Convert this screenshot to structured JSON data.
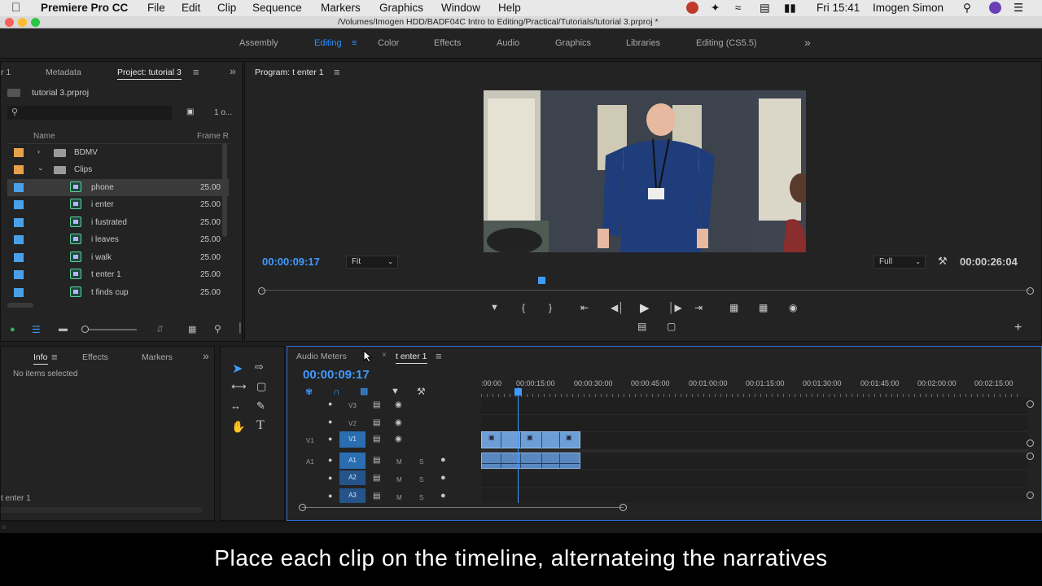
{
  "menubar": {
    "app_name": "Premiere Pro CC",
    "menus": [
      "File",
      "Edit",
      "Clip",
      "Sequence",
      "Markers",
      "Graphics",
      "Window",
      "Help"
    ],
    "clock": "Fri 15:41",
    "user": "Imogen Simon"
  },
  "window": {
    "path": "/Volumes/Imogen HDD/BADF04C Intro to Editing/Practical/Tutorials/tutorial 3.prproj *"
  },
  "workspaces": {
    "tabs": [
      "Assembly",
      "Editing",
      "Color",
      "Effects",
      "Audio",
      "Graphics",
      "Libraries",
      "Editing (CS5.5)"
    ],
    "active": "Editing",
    "overflow": "»"
  },
  "project": {
    "tabs": [
      "r 1",
      "Metadata",
      "Project: tutorial 3"
    ],
    "file": "tutorial 3.prproj",
    "item_count": "1 o...",
    "col_name": "Name",
    "col_frame": "Frame R",
    "rows": [
      {
        "name": "BDMV",
        "type": "folder",
        "color": "#e8a04a",
        "frame": ""
      },
      {
        "name": "Clips",
        "type": "folder",
        "color": "#e8a04a",
        "frame": ""
      },
      {
        "name": "phone",
        "type": "clip",
        "color": "#4aa0e8",
        "frame": "25.00"
      },
      {
        "name": "i enter",
        "type": "clip",
        "color": "#4aa0e8",
        "frame": "25.00"
      },
      {
        "name": "i fustrated",
        "type": "clip",
        "color": "#4aa0e8",
        "frame": "25.00"
      },
      {
        "name": "i leaves",
        "type": "clip",
        "color": "#4aa0e8",
        "frame": "25.00"
      },
      {
        "name": "i walk",
        "type": "clip",
        "color": "#4aa0e8",
        "frame": "25.00"
      },
      {
        "name": "t enter 1",
        "type": "clip",
        "color": "#4aa0e8",
        "frame": "25.00"
      },
      {
        "name": "t finds cup",
        "type": "clip",
        "color": "#4aa0e8",
        "frame": "25.00"
      }
    ]
  },
  "program": {
    "title": "Program: t enter 1",
    "timecode": "00:00:09:17",
    "fit": "Fit",
    "quality": "Full",
    "duration": "00:00:26:04"
  },
  "info": {
    "tabs": [
      "Info",
      "Effects",
      "Markers"
    ],
    "empty_text": "No items selected",
    "footer": "t enter 1"
  },
  "timeline": {
    "tabs": [
      "Audio Meters",
      "t enter 1"
    ],
    "timecode": "00:00:09:17",
    "ruler": [
      ":00:00",
      "00:00:15:00",
      "00:00:30:00",
      "00:00:45:00",
      "00:01:00:00",
      "00:01:15:00",
      "00:01:30:00",
      "00:01:45:00",
      "00:02:00:00",
      "00:02:15:00"
    ],
    "video_tracks": [
      {
        "src": "",
        "name": "V3"
      },
      {
        "src": "",
        "name": "V2"
      },
      {
        "src": "V1",
        "name": "V1"
      }
    ],
    "audio_tracks": [
      {
        "src": "A1",
        "name": "A1"
      },
      {
        "src": "",
        "name": "A2"
      },
      {
        "src": "",
        "name": "A3"
      }
    ],
    "m": "M",
    "s": "S"
  },
  "caption": "Place each clip on the timeline, alternateing the narratives",
  "colors": {
    "accent": "#2f8fff",
    "panel": "#232323",
    "clip_video": "#6d9fd6",
    "clip_audio": "#5b87bf"
  }
}
